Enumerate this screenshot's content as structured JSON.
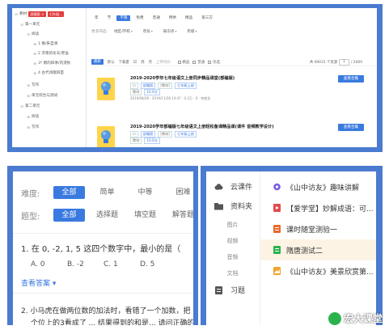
{
  "top": {
    "tree": {
      "root": "教材",
      "chips": [
        "部编版 ×",
        "七年级..."
      ],
      "items": [
        {
          "label": "第一单元",
          "toggle": "⊟"
        },
        {
          "label": "阅读",
          "toggle": "⊟"
        },
        {
          "label": "1 春/朱自清",
          "toggle": "⊞"
        },
        {
          "label": "2 济南的冬天/老舍",
          "toggle": "⊞"
        },
        {
          "label": "3* 雨的四季/刘湛秋",
          "toggle": "⊞"
        },
        {
          "label": "4 古代诗歌四首",
          "toggle": "⊞"
        },
        {
          "label": "写作",
          "toggle": "⊞"
        },
        {
          "label": "单元综合与测试",
          "toggle": "⊞"
        },
        {
          "label": "第二单元",
          "toggle": "⊟"
        },
        {
          "label": "阅读",
          "toggle": "⊞"
        },
        {
          "label": "写作",
          "toggle": "⊞"
        }
      ]
    },
    "filters": {
      "row1": [
        "不限",
        "普通",
        "免费",
        "普通",
        "特供",
        "精品",
        "第三方"
      ],
      "row1_first": "年",
      "row1_active_index": 0,
      "row2_label": "更多筛选:",
      "row2": [
        "地区/学校",
        "年份",
        "知识点",
        "年级"
      ]
    },
    "listbar": {
      "sort_label": "最新",
      "tabs": [
        "默认",
        "下载量",
        "日",
        "周",
        "月"
      ],
      "options_label": "上传时间",
      "checks": [
        "精品",
        "普通",
        "优选"
      ],
      "count": "共 69031 个资源",
      "page": "1",
      "total": "/ 2000"
    },
    "results": [
      {
        "title": "2019-2020学年七年级语文上册同步精品课堂(部编版)",
        "tags": [
          "部编版",
          "[教材]",
          "七年级上册"
        ],
        "tags2": [
          "教材",
          "10.0分"
        ],
        "meta": "2019/08/28 · 2019/11/28 14:47 · 0.3万 · 0 · 李俊龙",
        "button": "查看合集"
      },
      {
        "title": "2019-2020学年部编版七年级语文上册轻松备课精品课(课件 音频教学设计)",
        "tags": [
          "部编版",
          "[教材]",
          "七年级上册"
        ],
        "tags2": [
          "教材",
          "10.0分"
        ],
        "meta": "",
        "button": "查看合集"
      }
    ]
  },
  "question_filter": {
    "difficulty_label": "难度:",
    "difficulty": [
      "全部",
      "简单",
      "中等",
      "困难"
    ],
    "type_label": "题型:",
    "types": [
      "全部",
      "选择题",
      "填空题",
      "解答题"
    ]
  },
  "question1": {
    "text": "1. 在 0, -2, 1, 5 这四个数字中，最小的是（　　）",
    "options": [
      "A. 0",
      "B. -2",
      "C. 1",
      "D. 5"
    ],
    "answer_link": "查看答案 ▾"
  },
  "question2": {
    "line1": "2.  小马虎在做两位数的加法时，看错了一个加数，把",
    "line2": "个位上的3看成了 ... 结果得到的和是... 请问正确的结果"
  },
  "drive": {
    "side": [
      {
        "label": "云课件",
        "icon": "cloud-icon"
      },
      {
        "label": "资料夹",
        "icon": "folder-icon"
      }
    ],
    "sub": [
      "图片",
      "视频",
      "音频",
      "文档"
    ],
    "sub_active_index": 3,
    "side_bottom": {
      "label": "习题",
      "icon": "exercise-icon"
    },
    "files": [
      {
        "name": "《山中访友》趣味讲解",
        "icon": "video-icon",
        "color": "#7b5be0"
      },
      {
        "name": "【爱学堂】妙解成语：可...",
        "icon": "video-icon",
        "color": "#e04c4c"
      },
      {
        "name": "课时随堂测验一",
        "icon": "doc-icon",
        "color": "#e86a2b"
      },
      {
        "name": "隋唐测试二",
        "icon": "doc-icon",
        "color": "#2bb24c"
      },
      {
        "name": "《山中访友》美景欣赏第...",
        "icon": "image-icon",
        "color": "#f0a530"
      }
    ],
    "active_file_index": 3,
    "watermark": "宏大课堂"
  }
}
